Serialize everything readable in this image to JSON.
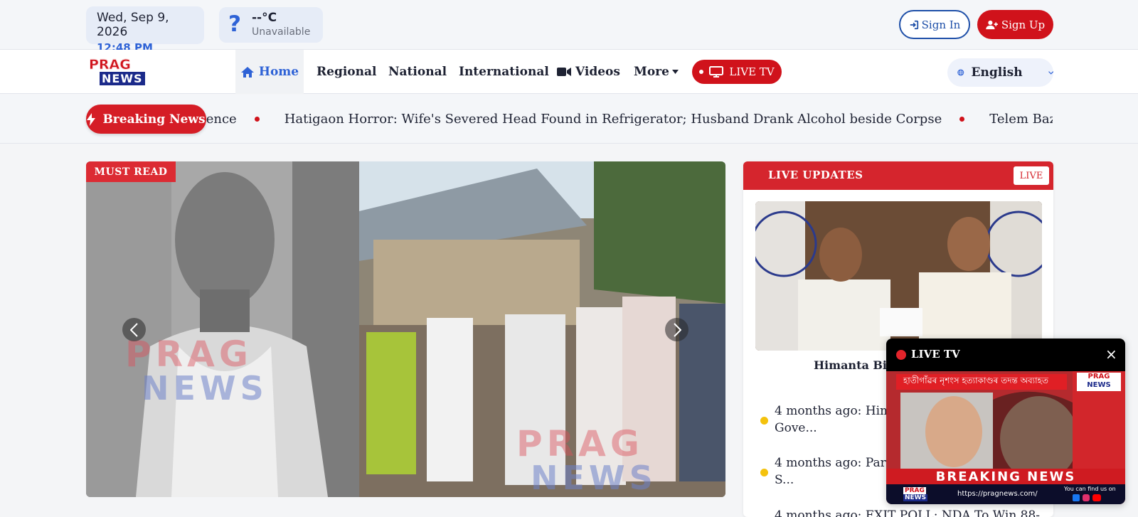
{
  "topbar": {
    "date": "Wed, Sep 9, 2026",
    "time": "12:48 PM",
    "weather_icon": "?",
    "temperature": "--°C",
    "weather_status": "Unavailable",
    "sign_in": "Sign In",
    "sign_up": "Sign Up"
  },
  "logo": {
    "line1": "PRAG",
    "line2": "NEWS"
  },
  "nav": {
    "items": [
      {
        "label": "Home",
        "icon": "home-icon"
      },
      {
        "label": "Regional"
      },
      {
        "label": "National"
      },
      {
        "label": "International"
      },
      {
        "label": "Videos",
        "icon": "video-camera-icon"
      },
      {
        "label": "More",
        "icon": "caret-down-icon"
      }
    ],
    "live_tv": "LIVE TV",
    "language": "English"
  },
  "ticker": {
    "label": "Breaking News",
    "items": [
      "Residence",
      "Hatigaon Horror: Wife's Severed Head Found in Refrigerator; Husband Drank Alcohol beside Corpse",
      "Telem Bazaar Tragedy:"
    ]
  },
  "hero": {
    "badge": "MUST READ",
    "watermark_1": "PRAG",
    "watermark_2": "NEWS"
  },
  "live_updates": {
    "title": "LIVE UPDATES",
    "badge": "LIVE",
    "headline": "Himanta Biswa Sarm... Go...",
    "items": [
      "4 months ago: Hima... Resignation to Gove...",
      "4 months ago: Parm... Clinches Chapar in S...",
      "4 months ago: EXIT POLL: NDA To Win 88-100..."
    ]
  },
  "floating_live": {
    "label": "LIVE TV",
    "close": "×",
    "strip_text": "হাতীগাঁৱৰ নৃশংস হত্যাকাণ্ডৰ তদন্ত অব্যাহত",
    "breaking": "BREAKING NEWS",
    "url": "https://pragnews.com/",
    "find_us": "You can find us on"
  },
  "colors": {
    "brand_red": "#d0121b",
    "brand_blue": "#2e62d6",
    "dark_blue": "#1b2a8a"
  }
}
